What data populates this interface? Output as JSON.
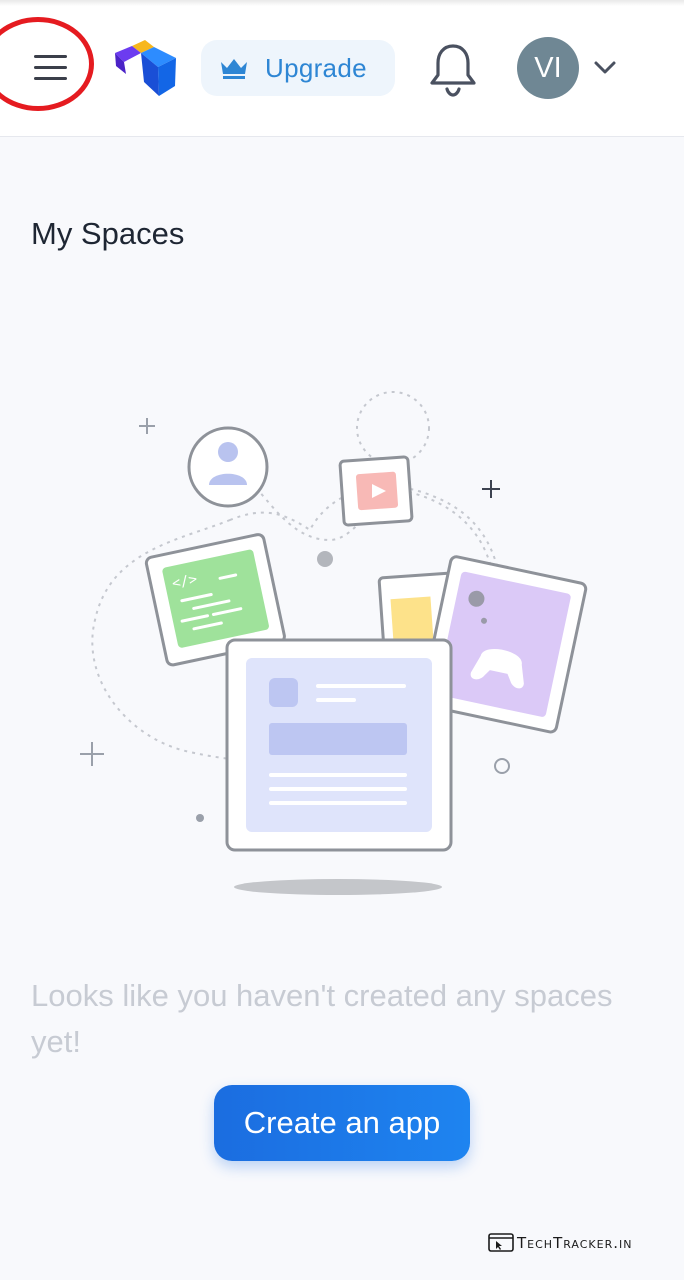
{
  "header": {
    "menu_icon": "hamburger-menu-icon",
    "logo_icon": "app-logo-icon",
    "upgrade": {
      "label": "Upgrade",
      "icon": "crown-icon"
    },
    "notifications_icon": "bell-icon",
    "user": {
      "initials": "VI",
      "dropdown_icon": "chevron-down-icon"
    },
    "highlight_color": "#e51b20"
  },
  "main": {
    "title": "My Spaces",
    "illustration": "empty-spaces-illustration",
    "empty_message": "Looks like you haven't created any spaces yet!",
    "create_button_label": "Create an app"
  },
  "watermark": {
    "text": "TechTracker.in"
  },
  "colors": {
    "accent": "#1e7be8",
    "upgrade_text": "#2e86d4",
    "upgrade_bg": "#eef5fc",
    "avatar_bg": "#6f8794",
    "empty_text": "#c7cbd3"
  }
}
